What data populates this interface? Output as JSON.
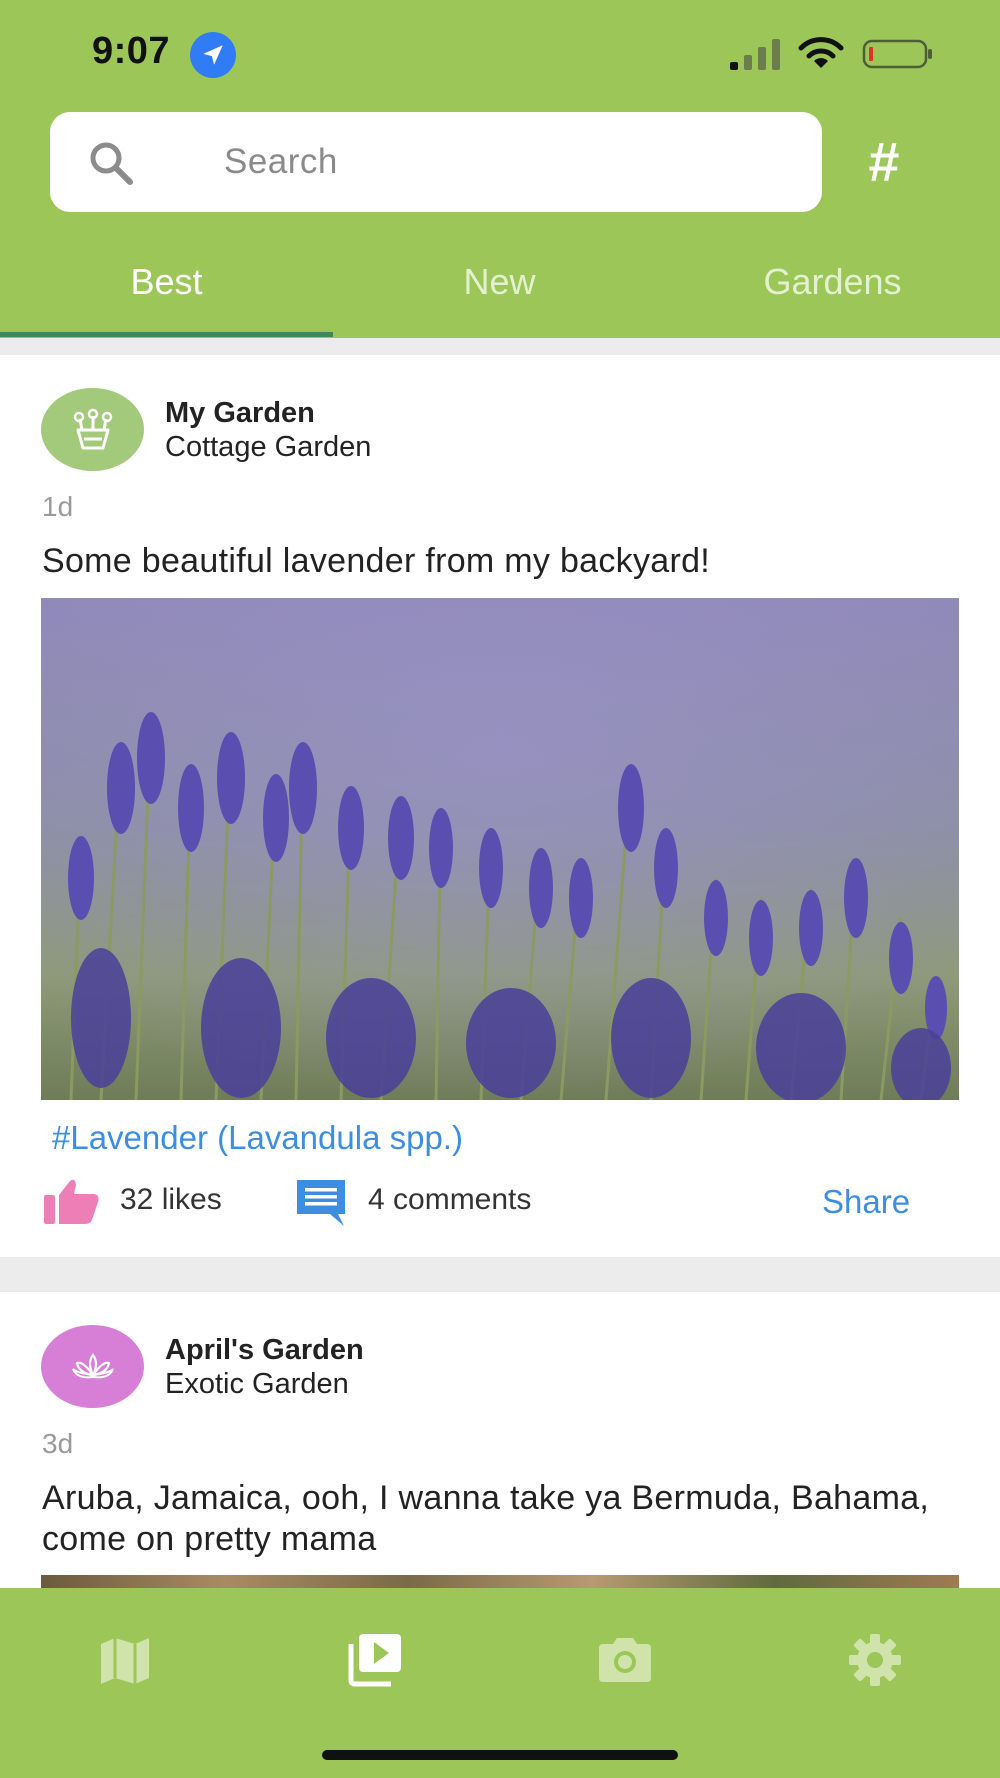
{
  "status_bar": {
    "time": "9:07"
  },
  "search": {
    "placeholder": "Search",
    "hashtag_button": "#"
  },
  "tabs": [
    {
      "label": "Best",
      "active": true
    },
    {
      "label": "New",
      "active": false
    },
    {
      "label": "Gardens",
      "active": false
    }
  ],
  "posts": [
    {
      "author": "My Garden",
      "garden_type": "Cottage Garden",
      "age": "1d",
      "text": "Some beautiful lavender from my backyard!",
      "hashtag": "#Lavender (Lavandula spp.)",
      "likes": "32 likes",
      "comments": "4 comments",
      "share": "Share",
      "avatar_color": "#a3c97a",
      "avatar_icon": "flower-pot-icon"
    },
    {
      "author": "April's Garden",
      "garden_type": "Exotic Garden",
      "age": "3d",
      "text": "Aruba, Jamaica, ooh, I wanna take ya Bermuda, Bahama, come on pretty mama",
      "avatar_color": "#d77ed6",
      "avatar_icon": "lotus-icon"
    }
  ],
  "bottom_nav": [
    {
      "icon": "map-icon",
      "active": false
    },
    {
      "icon": "feed-icon",
      "active": true
    },
    {
      "icon": "camera-icon",
      "active": false
    },
    {
      "icon": "settings-gear-icon",
      "active": false
    }
  ],
  "colors": {
    "brand_green": "#9cc657",
    "tab_underline": "#3c8a58",
    "link_blue": "#3d8ee0",
    "like_pink": "#ee7fb6",
    "comment_blue": "#3d8ee0"
  }
}
